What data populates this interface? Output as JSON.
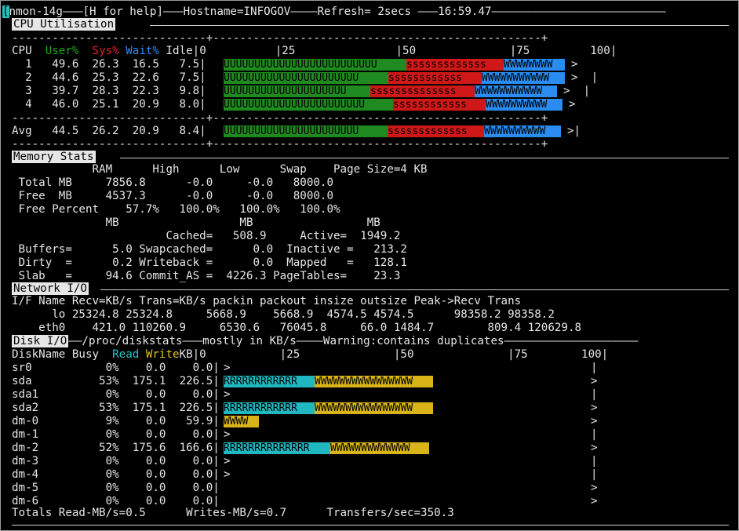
{
  "header": {
    "cursor": "[",
    "line": "nmon-14g———[H for help]———Hostname=INFOGOV————Refresh= 2secs ———16:59.47——————————————————————————"
  },
  "cpu": {
    "title": "CPU Utilisation",
    "dash_line": "-----------------------------+-------------------------------------------------+",
    "head_cpu": "CPU",
    "head_user": "User%",
    "head_sys": "Sys%",
    "head_wait": "Wait%",
    "head_idle": "Idle|0",
    "scale": "|25               |50              |75         100|",
    "rows": [
      {
        "cpu": "1",
        "user": "49.6",
        "sys": "26.3",
        "wait": "16.5",
        "idle": "7.5",
        "u_pct": 49.6,
        "s_pct": 26.3,
        "w_pct": 16.5,
        "end": ">"
      },
      {
        "cpu": "2",
        "user": "44.6",
        "sys": "25.3",
        "wait": "22.6",
        "idle": "7.5",
        "u_pct": 44.6,
        "s_pct": 25.3,
        "w_pct": 22.6,
        "end": ">  |"
      },
      {
        "cpu": "3",
        "user": "39.7",
        "sys": "28.3",
        "wait": "22.3",
        "idle": "9.8",
        "u_pct": 39.7,
        "s_pct": 28.3,
        "w_pct": 22.3,
        "end": ">  |"
      },
      {
        "cpu": "4",
        "user": "46.0",
        "sys": "25.1",
        "wait": "20.9",
        "idle": "8.0",
        "u_pct": 46.0,
        "s_pct": 25.1,
        "w_pct": 20.9,
        "end": ">"
      }
    ],
    "avg": {
      "label": "Avg",
      "user": "44.5",
      "sys": "26.2",
      "wait": "20.9",
      "idle": "8.4",
      "u_pct": 44.5,
      "s_pct": 26.2,
      "w_pct": 20.9,
      "end": ">|"
    }
  },
  "memory": {
    "title": "Memory Stats",
    "lines": [
      "            RAM      High      Low      Swap    Page Size=4 KB",
      " Total MB     7856.8      -0.0     -0.0   8000.0",
      " Free  MB     4537.3      -0.0     -0.0   8000.0",
      " Free Percent    57.7%   100.0%   100.0%   100.0%",
      "              MB                  MB                 MB",
      "                       Cached=   508.9     Active=  1949.2",
      " Buffers=      5.0 Swapcached=      0.0  Inactive =   213.2",
      " Dirty  =      0.2 Writeback =      0.0  Mapped   =   128.1",
      " Slab   =     94.6 Commit_AS =  4226.3 PageTables=    23.3"
    ]
  },
  "network": {
    "title": "Network I/O",
    "lines": [
      "I/F Name Recv=KB/s Trans=KB/s packin packout insize outsize Peak->Recv Trans",
      "      lo 25324.8 25324.8     5668.9    5668.9  4574.5 4574.5      98358.2 98358.2",
      "    eth0    421.0 110260.9     6530.6   76045.8     66.0 1484.7        809.4 120629.8"
    ]
  },
  "disk": {
    "title": "Disk I/O",
    "title_rest": "——/proc/diskstats———mostly in KB/s————Warning:contains duplicates————————————————————",
    "head_name": "DiskName Busy  ",
    "head_read": "Read ",
    "head_write": "Write",
    "head_rest": "KB|0           |25              |50              |75        100|",
    "rows": [
      {
        "name": "sr0",
        "busy": "0%",
        "read": "0.0",
        "write": "0.0",
        "r_pct": 0,
        "w_pct": 0,
        "marker": ">",
        "end": "|"
      },
      {
        "name": "sda",
        "busy": "53%",
        "read": "175.1",
        "write": "226.5",
        "r_pct": 23,
        "w_pct": 30,
        "marker": "",
        "end": ">"
      },
      {
        "name": "sda1",
        "busy": "0%",
        "read": "0.0",
        "write": "0.0",
        "r_pct": 0,
        "w_pct": 0,
        "marker": ">",
        "end": "|"
      },
      {
        "name": "sda2",
        "busy": "53%",
        "read": "175.1",
        "write": "226.5",
        "r_pct": 23,
        "w_pct": 30,
        "marker": "",
        "end": ">"
      },
      {
        "name": "dm-0",
        "busy": "9%",
        "read": "0.0",
        "write": "59.9",
        "r_pct": 0,
        "w_pct": 9,
        "marker": "",
        "end": ">"
      },
      {
        "name": "dm-1",
        "busy": "0%",
        "read": "0.0",
        "write": "0.0",
        "r_pct": 0,
        "w_pct": 0,
        "marker": ">",
        "end": "|"
      },
      {
        "name": "dm-2",
        "busy": "52%",
        "read": "175.6",
        "write": "166.6",
        "r_pct": 27,
        "w_pct": 25,
        "marker": "",
        "end": ">"
      },
      {
        "name": "dm-3",
        "busy": "0%",
        "read": "0.0",
        "write": "0.0",
        "r_pct": 0,
        "w_pct": 0,
        "marker": ">",
        "end": "|"
      },
      {
        "name": "dm-4",
        "busy": "0%",
        "read": "0.0",
        "write": "0.0",
        "r_pct": 0,
        "w_pct": 0,
        "marker": ">",
        "end": "|"
      },
      {
        "name": "dm-5",
        "busy": "0%",
        "read": "0.0",
        "write": "0.0",
        "r_pct": 0,
        "w_pct": 0,
        "marker": "",
        "end": ">"
      },
      {
        "name": "dm-6",
        "busy": "0%",
        "read": "0.0",
        "write": "0.0",
        "r_pct": 0,
        "w_pct": 0,
        "marker": "",
        "end": ">"
      }
    ],
    "totals": "Totals Read-MB/s=0.5      Writes-MB/s=0.7      Transfers/sec=350.3"
  }
}
